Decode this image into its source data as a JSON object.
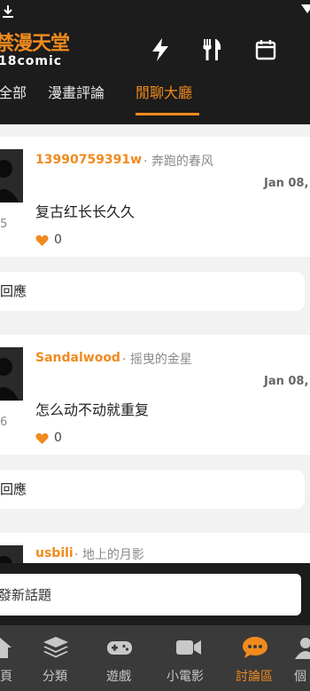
{
  "header": {
    "logo_cn": "禁漫天堂",
    "logo_en": "18comic"
  },
  "tabs": [
    {
      "label": "全部"
    },
    {
      "label": "漫畫評論"
    },
    {
      "label": "閒聊大廳"
    }
  ],
  "posts": [
    {
      "username": "13990759391w",
      "meta": "· 奔跑的春风",
      "date": "Jan 08,",
      "text": "复古红长长久久",
      "likes": "0",
      "avatar_num": "5",
      "reply_label": "回應"
    },
    {
      "username": "Sandalwood",
      "meta": "· 摇曳的金星",
      "date": "Jan 08,",
      "text": "怎么动不动就重复",
      "likes": "0",
      "avatar_num": "6",
      "reply_label": "回應"
    },
    {
      "username": "usbili",
      "meta": "· 地上的月影"
    }
  ],
  "new_topic": {
    "label": "發新話題"
  },
  "bottom_nav": [
    {
      "label": "頁",
      "icon": "home-icon"
    },
    {
      "label": "分類",
      "icon": "layers-icon"
    },
    {
      "label": "遊戲",
      "icon": "gamepad-icon"
    },
    {
      "label": "小電影",
      "icon": "video-icon"
    },
    {
      "label": "討論區",
      "icon": "chat-icon",
      "active": true
    },
    {
      "label": "個",
      "icon": "person-icon"
    }
  ],
  "colors": {
    "accent": "#f08a1e",
    "bar_bg": "#1c1c1c",
    "nav_bg": "#3a3a3a",
    "feed_bg": "#f2f2f2"
  }
}
